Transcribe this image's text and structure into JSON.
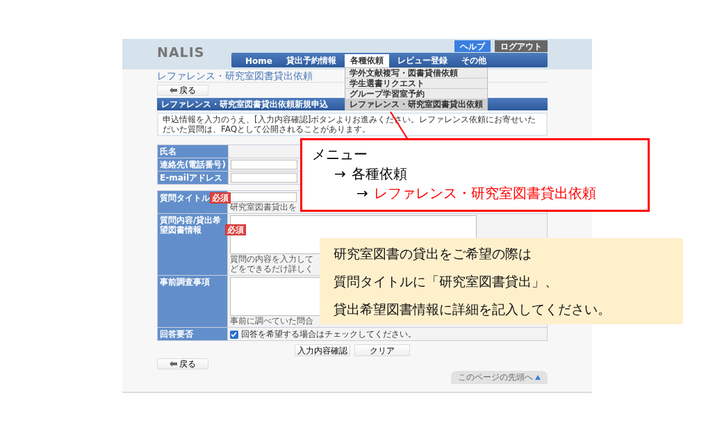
{
  "logo": "NALIS",
  "header_buttons": [
    {
      "label": "ヘルプ",
      "kind": "primary"
    },
    {
      "label": "ログアウト",
      "kind": "secondary"
    }
  ],
  "nav": [
    {
      "label": "Home",
      "selected": false
    },
    {
      "label": "貸出予約情報",
      "selected": false
    },
    {
      "label": "各種依頼",
      "selected": true
    },
    {
      "label": "レビュー登録",
      "selected": false
    },
    {
      "label": "その他",
      "selected": false
    }
  ],
  "dropdown": [
    {
      "label": "学外文献複写・図書貸借依頼",
      "selected": false
    },
    {
      "label": "学生選書リクエスト",
      "selected": false
    },
    {
      "label": "グループ学習室予約",
      "selected": false
    },
    {
      "label": "レファレンス・研究室図書貸出依頼",
      "selected": true
    }
  ],
  "page_title": "レファレンス・研究室図書貸出依頼",
  "back_button_top": "戻る",
  "section_title": "レファレンス・研究室図書貸出依頼新規申込",
  "notice": "申込情報を入力のうえ、[入力内容確認]ボタンよりお進みください。レファレンス依頼にお寄せいただいた質問は、FAQとして公開されることがあります。",
  "contact_rows": [
    {
      "label": "氏名",
      "kind": "static"
    },
    {
      "label": "連絡先(電話番号)",
      "kind": "input"
    },
    {
      "label": "E-mailアドレス",
      "kind": "input"
    }
  ],
  "question_rows": [
    {
      "label": "質問タイトル",
      "required": "必須",
      "kind": "input",
      "hint": [
        "研究室図書貸出を"
      ]
    },
    {
      "label": "質問内容/貸出希望図書情報",
      "required": "必須",
      "kind": "textarea",
      "hint": [
        "質問の内容を入力して",
        "どをできるだけ詳しく"
      ]
    },
    {
      "label": "事前調査事項",
      "kind": "textarea",
      "hint": [
        "事前に調べていた問合"
      ]
    },
    {
      "label": "回答要否",
      "kind": "checkbox",
      "checked": true,
      "text": "回答を希望する場合はチェックしてください。"
    }
  ],
  "actions": [
    "入力内容確認",
    "クリア"
  ],
  "back_button_bottom": "戻る",
  "page_top_link": "このページの先頭へ",
  "callout_menu": [
    {
      "text": "メニュー",
      "kind": "plain"
    },
    {
      "arrow": "→",
      "text": "各種依頼",
      "kind": "plain"
    },
    {
      "arrow": "→",
      "text": "レファレンス・研究室図書貸出依頼",
      "kind": "highlight"
    }
  ],
  "callout_note": [
    "研究室図書の貸出をご希望の際は",
    "質問タイトルに「研究室図書貸出」、",
    "貸出希望図書情報に詳細を記入してください。"
  ]
}
